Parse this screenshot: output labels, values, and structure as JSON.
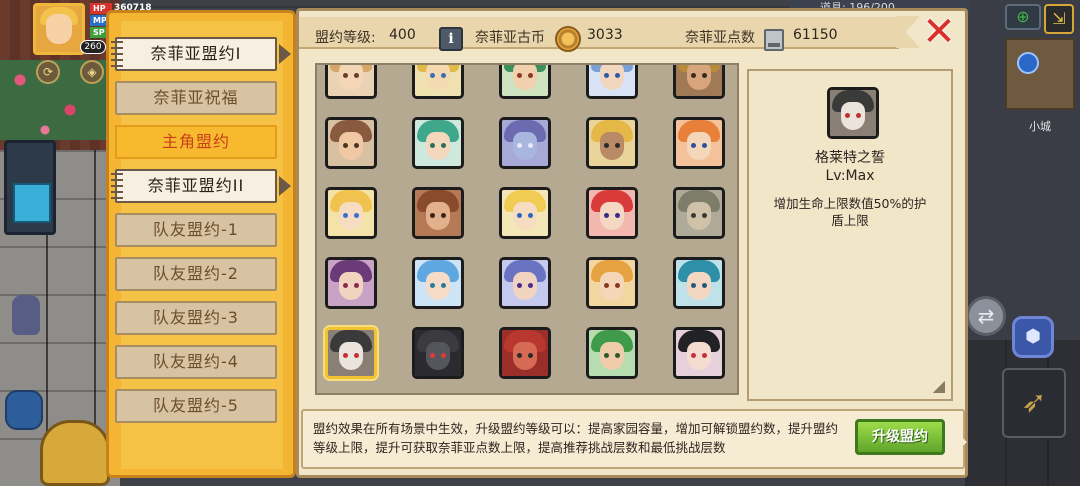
{
  "hud": {
    "stats": [
      {
        "key": "HP",
        "value": "360718",
        "color": "#d6342c",
        "width": 40
      },
      {
        "key": "MP",
        "value": "",
        "color": "#2a6fc7",
        "width": 40
      },
      {
        "key": "SP",
        "value": "",
        "color": "#3fa03a",
        "width": 40
      }
    ],
    "level": "260",
    "top_strip_text": "道具: 196/200",
    "minimap_label": "小城"
  },
  "tabs": [
    {
      "label": "奈菲亚盟约I",
      "state": "selected"
    },
    {
      "label": "奈菲亚祝福",
      "state": "normal"
    },
    {
      "label": "主角盟约",
      "state": "highlight"
    },
    {
      "label": "奈菲亚盟约II",
      "state": "selected-alt"
    },
    {
      "label": "队友盟约-1",
      "state": "normal"
    },
    {
      "label": "队友盟约-2",
      "state": "normal"
    },
    {
      "label": "队友盟约-3",
      "state": "normal"
    },
    {
      "label": "队友盟约-4",
      "state": "normal"
    },
    {
      "label": "队友盟约-5",
      "state": "normal"
    }
  ],
  "header": {
    "level_label": "盟约等级:",
    "level_value": "400",
    "coin_label": "奈菲亚古币",
    "coin_value": "3033",
    "points_label": "奈菲亚点数",
    "points_value": "61150"
  },
  "portraits": [
    {
      "hair": "#d7a76a",
      "skin": "#f3d6b6",
      "eye": "#6b3c2b",
      "bg": "#e9d3b4"
    },
    {
      "hair": "#e2b947",
      "skin": "#f5d9b0",
      "eye": "#3a6fb7",
      "bg": "#f0e2b0"
    },
    {
      "hair": "#3d8f5e",
      "skin": "#f1d0ad",
      "eye": "#8a3a2a",
      "bg": "#cfe3c0"
    },
    {
      "hair": "#7aa0d8",
      "skin": "#f2d7c0",
      "eye": "#2b5aa3",
      "bg": "#d8e3f5"
    },
    {
      "hair": "#b88b3a",
      "skin": "#d8a57c",
      "eye": "#3a2a1c",
      "bg": "#a07a56"
    },
    {
      "hair": "#8a5a3f",
      "skin": "#f0c9a4",
      "eye": "#4b3222",
      "bg": "#d8c0a3"
    },
    {
      "hair": "#3fa88c",
      "skin": "#f3d8be",
      "eye": "#2a6e5a",
      "bg": "#cfe8de"
    },
    {
      "hair": "#6c6ab0",
      "skin": "#a9b6e0",
      "eye": "#e8e8ff",
      "bg": "#a7a9d6"
    },
    {
      "hair": "#e6b847",
      "skin": "#b98a66",
      "eye": "#2a2a2a",
      "bg": "#e9d49a"
    },
    {
      "hair": "#e8803a",
      "skin": "#f4d6bb",
      "eye": "#2e4f9a",
      "bg": "#f3c29a"
    },
    {
      "hair": "#f0c34e",
      "skin": "#f6dcc0",
      "eye": "#3a6fd0",
      "bg": "#f4e3a8"
    },
    {
      "hair": "#8a4a2c",
      "skin": "#e2b08c",
      "eye": "#3a2416",
      "bg": "#b57a55"
    },
    {
      "hair": "#f1cc55",
      "skin": "#f6ddc2",
      "eye": "#2b66c4",
      "bg": "#f3e6b7"
    },
    {
      "hair": "#d93a3a",
      "skin": "#f4d8c4",
      "eye": "#3a2a8a",
      "bg": "#f2b8b0"
    },
    {
      "hair": "#7d7d6a",
      "skin": "#cfc2a8",
      "eye": "#3a3a3a",
      "bg": "#b0ab99"
    },
    {
      "hair": "#6b3a78",
      "skin": "#f2d3bf",
      "eye": "#8a2a4a",
      "bg": "#c9a3c6"
    },
    {
      "hair": "#5fa7e0",
      "skin": "#f4dcc8",
      "eye": "#2a7a9a",
      "bg": "#cde4f6"
    },
    {
      "hair": "#6a73c2",
      "skin": "#f0d4c0",
      "eye": "#4a2a8a",
      "bg": "#c6c9ee"
    },
    {
      "hair": "#e6a240",
      "skin": "#f5d6b8",
      "eye": "#8a3a1c",
      "bg": "#f2d6a0"
    },
    {
      "hair": "#2e8fa8",
      "skin": "#f3d7c2",
      "eye": "#1f5a7a",
      "bg": "#bfe2ea"
    },
    {
      "hair": "#3a3a3a",
      "skin": "#eae4dc",
      "eye": "#c23030",
      "bg": "#8a7f74"
    },
    {
      "hair": "#3b3b3f",
      "skin": "#55555c",
      "eye": "#e03a3a",
      "bg": "#2a2a30"
    },
    {
      "hair": "#b8382f",
      "skin": "#d76a55",
      "eye": "#2a2a2a",
      "bg": "#9a2f2a"
    },
    {
      "hair": "#3f9a4a",
      "skin": "#f0cdaa",
      "eye": "#2a5a2a",
      "bg": "#b6dcb0"
    },
    {
      "hair": "#222226",
      "skin": "#f4dcd0",
      "eye": "#c4303c",
      "bg": "#e6d0da"
    }
  ],
  "selected_index": 20,
  "detail": {
    "title": "格莱特之誓",
    "level": "Lv:Max",
    "description": "增加生命上限数值50%的护盾上限"
  },
  "footer": {
    "text": "盟约效果在所有场景中生效，升级盟约等级可以：提高家园容量，增加可解锁盟约数，提升盟约等级上限，提升可获取奈菲亚点数上限，提高推荐挑战层数和最低挑战层数",
    "upgrade_label": "升级盟约"
  }
}
